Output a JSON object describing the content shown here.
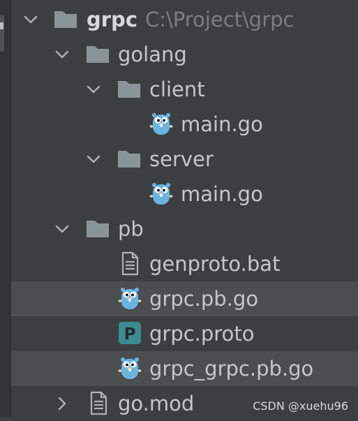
{
  "tree": {
    "root": {
      "label": "grpc",
      "path": "C:\\Project\\grpc",
      "icon": "folder-icon"
    },
    "golang": {
      "label": "golang",
      "icon": "folder-icon"
    },
    "client": {
      "label": "client",
      "icon": "folder-icon"
    },
    "client_main": {
      "label": "main.go",
      "icon": "gopher-icon"
    },
    "server": {
      "label": "server",
      "icon": "folder-icon"
    },
    "server_main": {
      "label": "main.go",
      "icon": "gopher-icon"
    },
    "pb": {
      "label": "pb",
      "icon": "folder-icon"
    },
    "genproto": {
      "label": "genproto.bat",
      "icon": "text-file-icon"
    },
    "grpc_pb_go": {
      "label": "grpc.pb.go",
      "icon": "gopher-icon"
    },
    "grpc_proto": {
      "label": "grpc.proto",
      "icon": "proto-file-icon",
      "badge": "P"
    },
    "grpc_grpc_pb_go": {
      "label": "grpc_grpc.pb.go",
      "icon": "gopher-icon"
    },
    "go_mod": {
      "label": "go.mod",
      "icon": "text-file-icon"
    }
  },
  "watermark": "CSDN @xuehu96",
  "colors": {
    "background": "#3c3f41",
    "row_highlight": "#4b4d4f",
    "text": "#c7c7c7",
    "path_text": "#7b7e81",
    "folder": "#8b9599",
    "gopher": "#6cb4e0",
    "proto_badge": "#3d8a8f"
  }
}
